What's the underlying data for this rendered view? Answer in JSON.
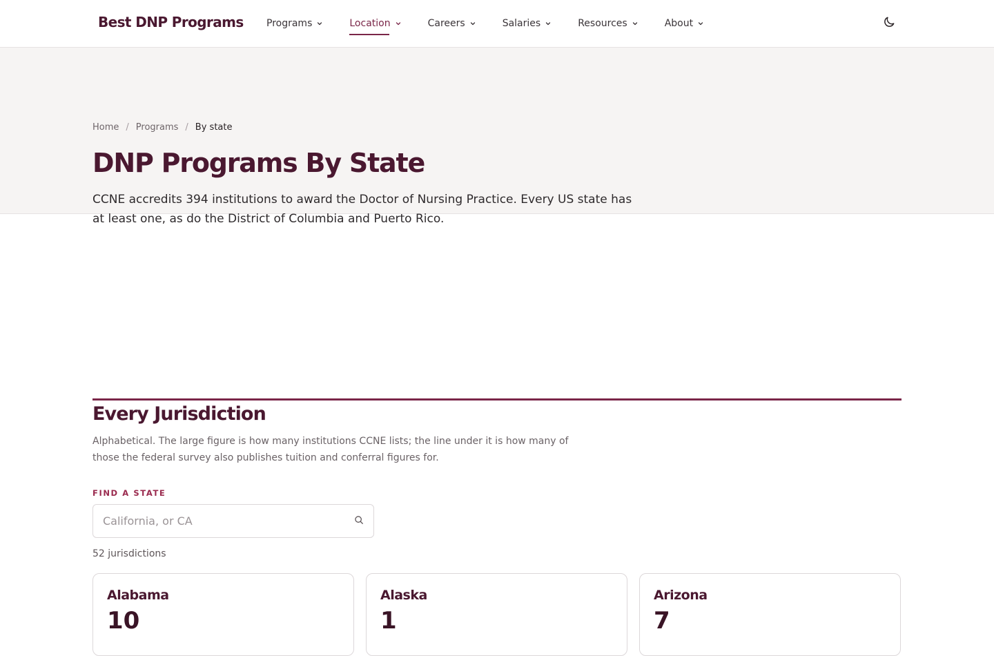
{
  "header": {
    "logo": "Best DNP Programs",
    "nav": [
      {
        "label": "Programs"
      },
      {
        "label": "Location"
      },
      {
        "label": "Careers"
      },
      {
        "label": "Salaries"
      },
      {
        "label": "Resources"
      },
      {
        "label": "About"
      }
    ],
    "active_nav": "Location",
    "theme_icon": "moon-icon"
  },
  "breadcrumb": {
    "items": [
      "Home",
      "Programs"
    ],
    "current": "By state",
    "separator": "/"
  },
  "hero": {
    "title": "DNP Programs By State",
    "lede": "CCNE accredits 394 institutions to award the Doctor of Nursing Practice. Every US state has at least one, as do the District of Columbia and Puerto Rico."
  },
  "section": {
    "title": "Every Jurisdiction",
    "description": "Alphabetical. The large figure is how many institutions CCNE lists; the line under it is how many of those the federal survey also publishes tuition and conferral figures for.",
    "find_label": "FIND A STATE",
    "search_placeholder": "California, or CA",
    "search_value": "",
    "count_text": "52 jurisdictions"
  },
  "states": [
    {
      "name": "Alabama",
      "count": "10"
    },
    {
      "name": "Alaska",
      "count": "1"
    },
    {
      "name": "Arizona",
      "count": "7"
    }
  ],
  "colors": {
    "brand": "#4a1830",
    "accent": "#7a2648",
    "hero_bg": "#f6f4f3"
  }
}
